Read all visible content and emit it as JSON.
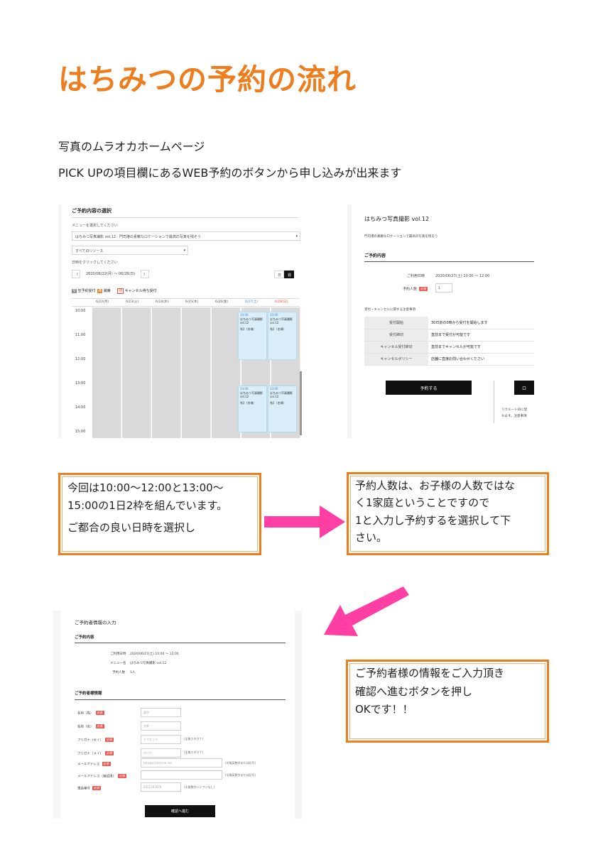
{
  "title": "はちみつの予約の流れ",
  "intro": {
    "line1": "写真のムラオカホームページ",
    "line2": "PICK UPの項目欄にあるWEB予約のボタンから申し込みが出来ます"
  },
  "shot1": {
    "heading": "ご予約内容の選択",
    "menu_label": "メニューを選択してください",
    "menu_value": "はちみつ写真撮影 vol.12：門司港の素敵なロケーションで最高の写真を残そう",
    "resource_value": "すべてのリソース",
    "date_label": "日時をクリックしてください",
    "date_range": "2020/06/22(月) 〜 06/28(日)",
    "prev": "〈",
    "next": "〉",
    "view_day": "日",
    "view_week": "週",
    "legend": [
      {
        "mark": "空",
        "label": "空予約受付"
      },
      {
        "mark": "満",
        "label": "満席"
      },
      {
        "mark": "待",
        "label": "キャンセル待ち受付"
      }
    ],
    "days": [
      "6/22(月)",
      "6/23(火)",
      "6/24(水)",
      "6/25(木)",
      "6/26(金)",
      "6/27(土)",
      "6/28(日)"
    ],
    "times": [
      "10:00",
      "11:00",
      "12:00",
      "13:00",
      "14:00",
      "15:00"
    ],
    "slots": [
      {
        "time": "10:00",
        "name": "はちみつ写真撮影 vol.12",
        "status": "残1（名様）"
      },
      {
        "time": "13:00",
        "name": "はちみつ写真撮影 vol.12",
        "status": "残1（名様）"
      }
    ],
    "accent": "#d9eef8"
  },
  "shot2": {
    "heading": "はちみつ写真撮影 vol.12",
    "sub": "門司港の素敵なロケーションで最高の写真を残そう",
    "section": "ご予約内容",
    "date_label": "ご利用日時",
    "date_value": "2020/06/27(土) 10:00 〜 12:00",
    "count_label": "予約人数",
    "required": "必須",
    "count_value": "1",
    "notes_title": "受付・キャンセルに関する注意事項",
    "rows": [
      {
        "h": "受付開始",
        "v": "30日前の0時から受付を開始します"
      },
      {
        "h": "受付締切",
        "v": "直前まで受付が可能です"
      },
      {
        "h": "キャンセル受付締切",
        "v": "直前までキャンセルが可能です"
      },
      {
        "h": "キャンセルポリシー",
        "v": "店舗に直接お問い合わせください"
      }
    ],
    "reserve_button": "予約する",
    "side_btn": "ロ",
    "side_text1": "リクルートIDに登",
    "side_text2": "れます。注意事項"
  },
  "callout1": {
    "line1": "今回は10:00〜12:00と13:00〜",
    "line2": "15:00の1日2枠を組んでいます。",
    "line3": "ご都合の良い日時を選択し"
  },
  "callout2": {
    "line1": "予約人数は、お子様の人数ではな",
    "line2": "く1家庭ということですので",
    "line3": "1と入力し予約するを選択して下",
    "line4": "さい。"
  },
  "callout3": {
    "line1": "ご予約者様の情報をご入力頂き",
    "line2": "確認へ進むボタンを押し",
    "line3": "OKです！！"
  },
  "shot3": {
    "heading": "ご予約者情報の入力",
    "section1": "ご予約内容",
    "date_label": "ご利用日時",
    "date_value": "2020/06/27(土) 10:00 〜 12:00",
    "menu_label": "メニュー名",
    "menu_value": "はちみつ写真撮影 vol.12",
    "count_label": "予約人数",
    "count_value": "1人",
    "section2": "ご予約者様情報",
    "required": "必須",
    "fields": [
      {
        "label": "名前（姓）",
        "placeholder": "東京",
        "note": ""
      },
      {
        "label": "名前（名）",
        "placeholder": "太郎",
        "note": ""
      },
      {
        "label": "フリガナ（セイ）",
        "placeholder": "トウキョウ",
        "note": "(全角カタカナ)"
      },
      {
        "label": "フリガナ（メイ）",
        "placeholder": "タロウ",
        "note": "(全角カタカナ)"
      },
      {
        "label": "メールアドレス",
        "placeholder": "taro@airreserve.net",
        "note": "(半角英数字または記号)"
      },
      {
        "label": "メールアドレス（確認用）",
        "placeholder": "",
        "note": "(半角英数字または記号)"
      },
      {
        "label": "電話番号",
        "placeholder": "0312345678",
        "note": "(半角数字ハイフンなし)"
      }
    ],
    "confirm_button": "確認へ進む"
  },
  "colors": {
    "accent": "#ee7d1e",
    "arrow": "#ff3fa4"
  }
}
